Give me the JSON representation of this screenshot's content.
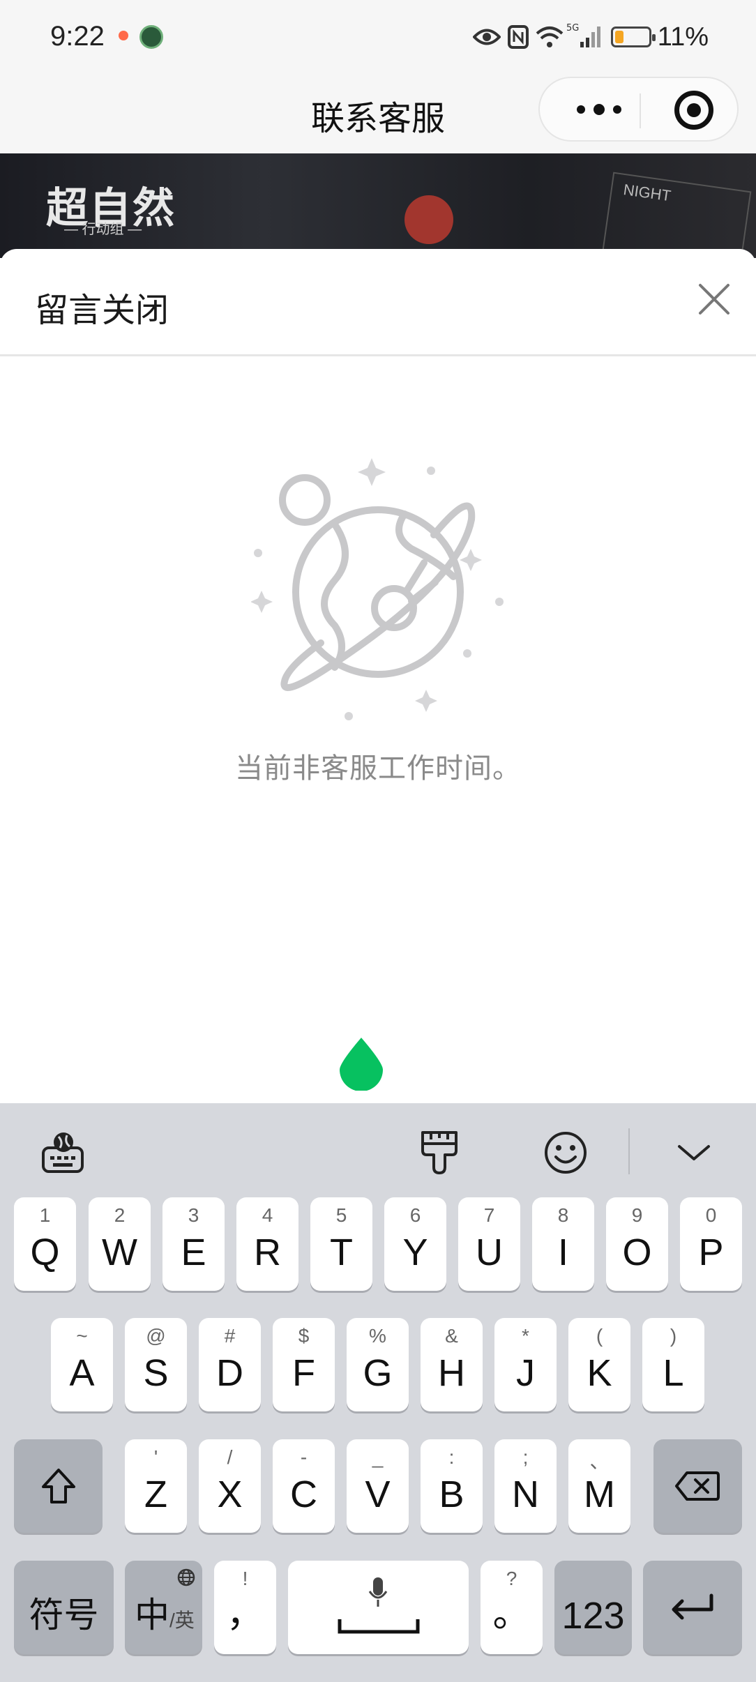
{
  "status_bar": {
    "time": "9:22",
    "battery_pct": "11%",
    "icons": [
      "eye-icon",
      "nfc-icon",
      "wifi-icon",
      "5g-signal-icon",
      "battery-icon"
    ]
  },
  "nav": {
    "title": "联系客服"
  },
  "banner": {
    "logo_text": "超自然",
    "logo_sub": "— 行动组 —",
    "card_text": "NIGHT"
  },
  "sheet": {
    "title": "留言关闭",
    "empty_message": "当前非客服工作时间。"
  },
  "keyboard": {
    "row1": [
      {
        "main": "Q",
        "sub": "1"
      },
      {
        "main": "W",
        "sub": "2"
      },
      {
        "main": "E",
        "sub": "3"
      },
      {
        "main": "R",
        "sub": "4"
      },
      {
        "main": "T",
        "sub": "5"
      },
      {
        "main": "Y",
        "sub": "6"
      },
      {
        "main": "U",
        "sub": "7"
      },
      {
        "main": "I",
        "sub": "8"
      },
      {
        "main": "O",
        "sub": "9"
      },
      {
        "main": "P",
        "sub": "0"
      }
    ],
    "row2": [
      {
        "main": "A",
        "sub": "~"
      },
      {
        "main": "S",
        "sub": "@"
      },
      {
        "main": "D",
        "sub": "#"
      },
      {
        "main": "F",
        "sub": "$"
      },
      {
        "main": "G",
        "sub": "%"
      },
      {
        "main": "H",
        "sub": "&"
      },
      {
        "main": "J",
        "sub": "*"
      },
      {
        "main": "K",
        "sub": "("
      },
      {
        "main": "L",
        "sub": ")"
      }
    ],
    "row3": [
      {
        "main": "Z",
        "sub": "'"
      },
      {
        "main": "X",
        "sub": "/"
      },
      {
        "main": "C",
        "sub": "-"
      },
      {
        "main": "V",
        "sub": "_"
      },
      {
        "main": "B",
        "sub": ":"
      },
      {
        "main": "N",
        "sub": ";"
      },
      {
        "main": "M",
        "sub": "、"
      }
    ],
    "symbols_label": "符号",
    "lang_main": "中",
    "lang_sub": "/英",
    "comma_main": "，",
    "comma_sub": "!",
    "period_main": "。",
    "period_sub": "?",
    "num_label": "123"
  },
  "colors": {
    "accent_green": "#07c160",
    "keyboard_bg": "#d6d8dd",
    "battery_low": "#f5a623"
  }
}
